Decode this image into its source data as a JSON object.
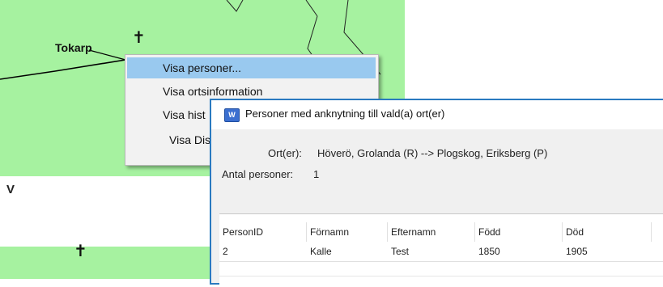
{
  "map": {
    "place_label": "Tokarp",
    "cross_symbol": "✝",
    "left_letter": "V",
    "background_color": "#a6f2a0"
  },
  "context_menu": {
    "items": [
      {
        "label": "Visa personer...",
        "highlighted": true
      },
      {
        "label": "Visa ortsinformation"
      },
      {
        "label": "Visa hist"
      },
      {
        "label": "Visa Dis"
      }
    ]
  },
  "dialog": {
    "icon": "app-icon",
    "title": "Personer med anknytning till vald(a) ort(er)",
    "ort_label": "Ort(er):",
    "ort_value": "Höverö, Grolanda (R) --> Plogskog, Eriksberg (P)",
    "count_label": "Antal personer:",
    "count_value": "1",
    "table": {
      "columns": [
        "PersonID",
        "Förnamn",
        "Efternamn",
        "Född",
        "Död"
      ],
      "rows": [
        [
          "2",
          "Kalle",
          "Test",
          "1850",
          "1905"
        ]
      ]
    },
    "accent_color": "#2a7ac0"
  }
}
